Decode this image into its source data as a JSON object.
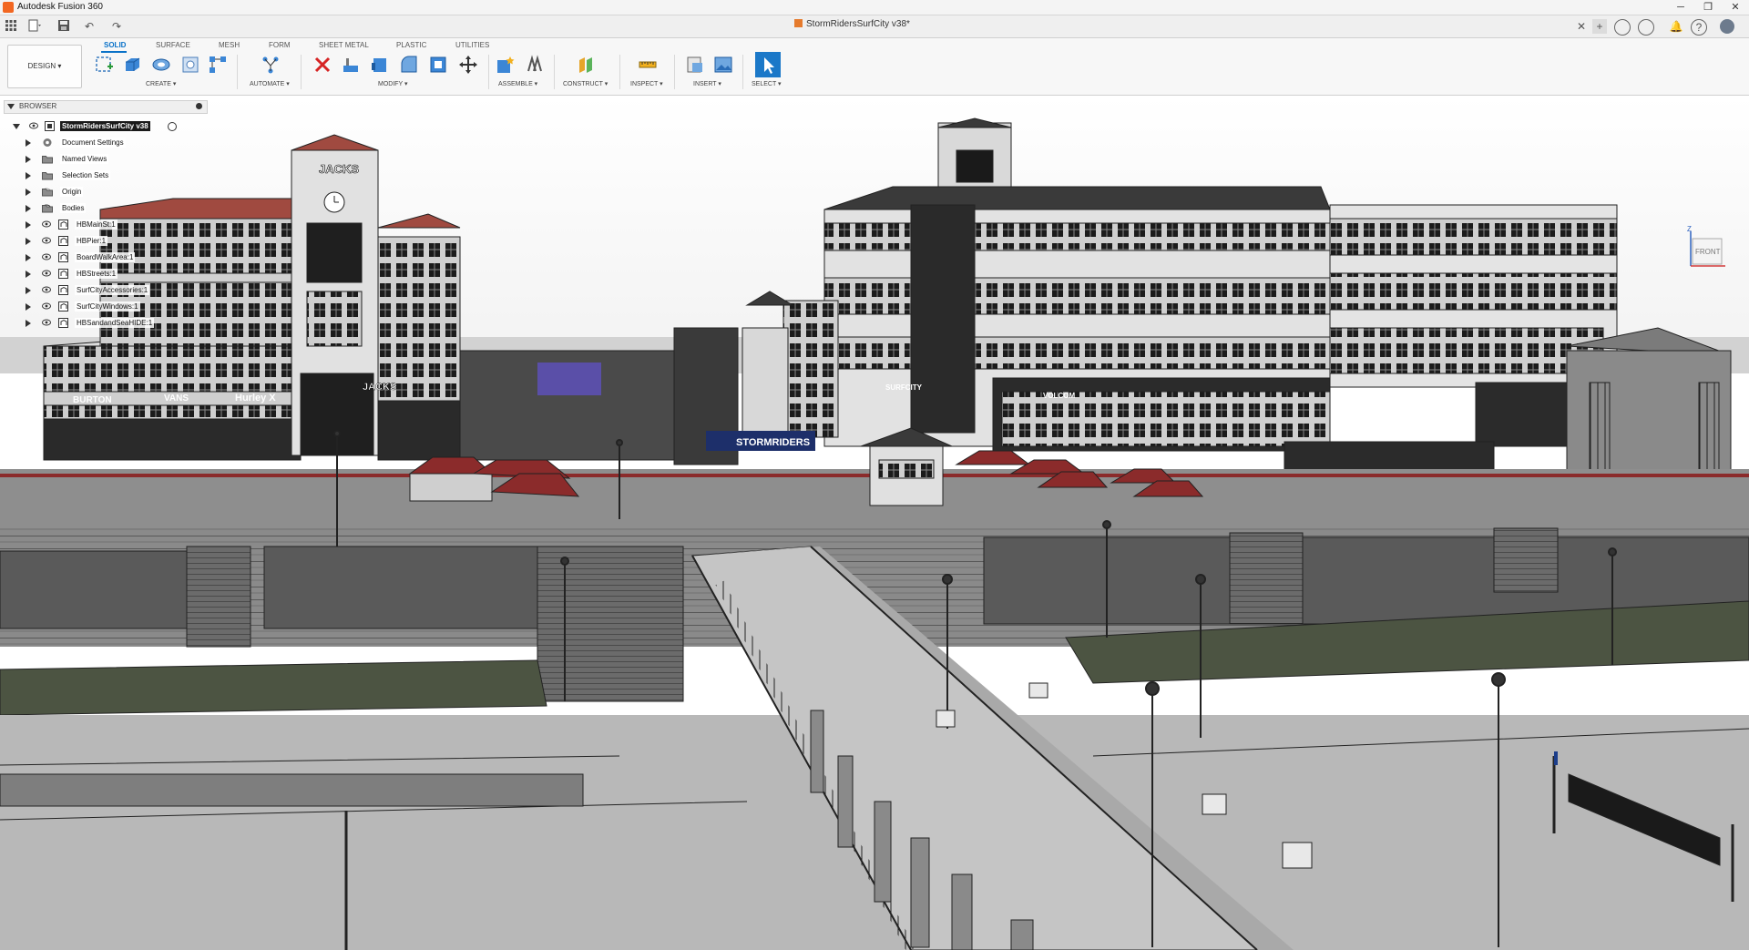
{
  "window": {
    "app_title": "Autodesk Fusion 360",
    "minimize_glyph": "─",
    "maximize_glyph": "❐",
    "close_glyph": "✕"
  },
  "doc_tab": {
    "title": "StormRidersSurfCity v38*",
    "close_glyph": "✕"
  },
  "ribbon": {
    "workspace": "DESIGN ▾",
    "tabs": [
      "SOLID",
      "SURFACE",
      "MESH",
      "FORM",
      "SHEET METAL",
      "PLASTIC",
      "UTILITIES"
    ],
    "groups": [
      "CREATE ▾",
      "AUTOMATE ▾",
      "MODIFY ▾",
      "ASSEMBLE ▾",
      "CONSTRUCT ▾",
      "INSPECT ▾",
      "INSERT ▾",
      "SELECT ▾"
    ]
  },
  "browser": {
    "title": "BROWSER",
    "root": "StormRidersSurfCity v38",
    "items": [
      {
        "label": "Document Settings",
        "icon": "gear-icon"
      },
      {
        "label": "Named Views",
        "icon": "folder-icon"
      },
      {
        "label": "Selection Sets",
        "icon": "folder-icon"
      },
      {
        "label": "Origin",
        "icon": "folder-icon"
      },
      {
        "label": "Bodies",
        "icon": "folder-icon"
      },
      {
        "label": "HBMainSt:1",
        "icon": "component-icon"
      },
      {
        "label": "HBPier:1",
        "icon": "component-icon"
      },
      {
        "label": "BoardWalkArea:1",
        "icon": "component-icon"
      },
      {
        "label": "HBStreets:1",
        "icon": "component-icon"
      },
      {
        "label": "SurfCityAccessories:1",
        "icon": "component-icon"
      },
      {
        "label": "SurfCityWindows:1",
        "icon": "component-icon"
      },
      {
        "label": "HBSandandSeaHIDE:1",
        "icon": "component-icon"
      }
    ]
  },
  "viewcube": {
    "face": "FRONT",
    "axis_z": "Z"
  },
  "scene": {
    "signs": [
      "JACKS",
      "BURTON",
      "VOLCOM",
      "STORMRIDERS",
      "Hurley X",
      "SURFCITY"
    ]
  },
  "colors": {
    "accent": "#0a72c8",
    "brand": "#f26722",
    "canopy_red": "#8b2b2b"
  }
}
